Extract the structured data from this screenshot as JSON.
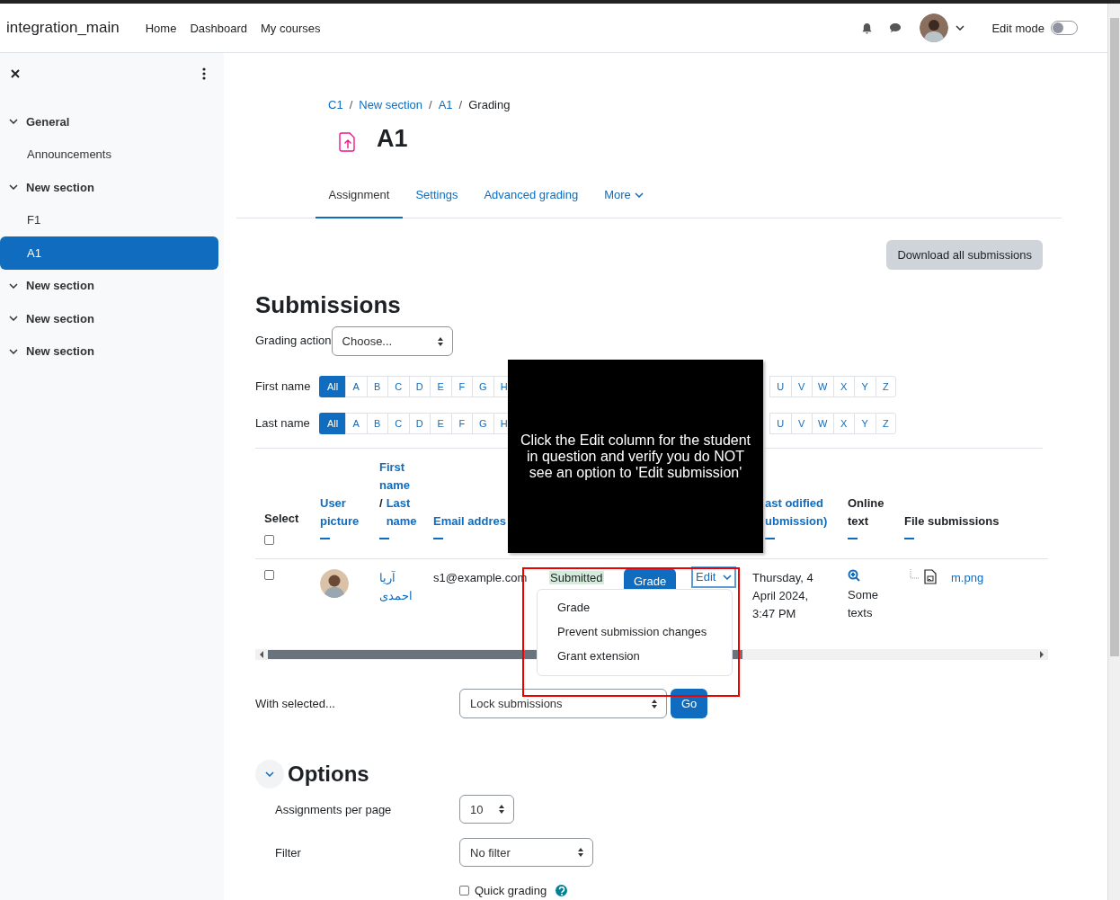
{
  "site_name": "integration_main",
  "nav": [
    {
      "label": "Home"
    },
    {
      "label": "Dashboard"
    },
    {
      "label": "My courses"
    }
  ],
  "edit_mode": {
    "label": "Edit mode",
    "on": false
  },
  "sidebar": {
    "items": [
      {
        "kind": "section",
        "label": "General",
        "expanded": true,
        "selected": false
      },
      {
        "kind": "activity",
        "label": "Announcements",
        "selected": false
      },
      {
        "kind": "section",
        "label": "New section",
        "expanded": true,
        "selected": false
      },
      {
        "kind": "activity",
        "label": "F1",
        "selected": false
      },
      {
        "kind": "activity",
        "label": "A1",
        "selected": true
      },
      {
        "kind": "section",
        "label": "New section",
        "expanded": true,
        "selected": false
      },
      {
        "kind": "section",
        "label": "New section",
        "expanded": true,
        "selected": false
      },
      {
        "kind": "section",
        "label": "New section",
        "expanded": true,
        "selected": false
      }
    ]
  },
  "breadcrumb": [
    {
      "label": "C1",
      "link": true
    },
    {
      "separator": "/",
      "label": "New section",
      "link": true
    },
    {
      "separator": "/",
      "label": "A1",
      "link": true
    },
    {
      "separator": "/",
      "label": "Grading",
      "link": false
    }
  ],
  "title": "A1",
  "tabs": [
    {
      "label": "Assignment",
      "selected": true,
      "menu": false
    },
    {
      "label": "Settings",
      "selected": false,
      "menu": false
    },
    {
      "label": "Advanced grading",
      "selected": false,
      "menu": false
    },
    {
      "label": "More",
      "selected": false,
      "menu": true
    }
  ],
  "download_button": "Download all submissions",
  "heading": "Submissions",
  "grading_action": {
    "label": "Grading action",
    "value": "Choose..."
  },
  "initials_filters": [
    {
      "label": "First name",
      "letters": [
        {
          "label": "All",
          "selected": true
        },
        {
          "label": "A",
          "selected": false
        },
        {
          "label": "B",
          "selected": false
        },
        {
          "label": "C",
          "selected": false
        },
        {
          "label": "D",
          "selected": false
        },
        {
          "label": "E",
          "selected": false
        },
        {
          "label": "F",
          "selected": false
        },
        {
          "label": "G",
          "selected": false
        },
        {
          "label": "H",
          "selected": false
        }
      ],
      "letters_right": [
        {
          "label": "U",
          "selected": false
        },
        {
          "label": "V",
          "selected": false
        },
        {
          "label": "W",
          "selected": false
        },
        {
          "label": "X",
          "selected": false
        },
        {
          "label": "Y",
          "selected": false
        },
        {
          "label": "Z",
          "selected": false
        }
      ]
    },
    {
      "label": "Last name",
      "letters": [
        {
          "label": "All",
          "selected": true
        },
        {
          "label": "A",
          "selected": false
        },
        {
          "label": "B",
          "selected": false
        },
        {
          "label": "C",
          "selected": false
        },
        {
          "label": "D",
          "selected": false
        },
        {
          "label": "E",
          "selected": false
        },
        {
          "label": "F",
          "selected": false
        },
        {
          "label": "G",
          "selected": false
        },
        {
          "label": "H",
          "selected": false
        }
      ],
      "letters_right": [
        {
          "label": "U",
          "selected": false
        },
        {
          "label": "V",
          "selected": false
        },
        {
          "label": "W",
          "selected": false
        },
        {
          "label": "X",
          "selected": false
        },
        {
          "label": "Y",
          "selected": false
        },
        {
          "label": "Z",
          "selected": false
        }
      ]
    }
  ],
  "table": {
    "columns": [
      {
        "kind": "select",
        "label": "Select",
        "checked": false
      },
      {
        "kind": "sortable",
        "label": "User picture"
      },
      {
        "kind": "name",
        "first": "First name",
        "separator": "/",
        "last": "Last name"
      },
      {
        "kind": "sortable",
        "label": "Email addres"
      },
      {
        "kind": "hidden"
      },
      {
        "kind": "hidden"
      },
      {
        "kind": "hidden"
      },
      {
        "kind": "sortable",
        "label": "ast odified ubmission)"
      },
      {
        "kind": "plain_sort",
        "label": "Online text"
      },
      {
        "kind": "plain_sort",
        "label": "File submissions"
      }
    ],
    "rows": [
      {
        "checked": false,
        "name": "آریا احمدی",
        "email": "s1@example.com",
        "status": "Submitted",
        "grade_button": "Grade",
        "edit_button": "Edit",
        "last_modified": "Thursday, 4 April 2024, 3:47 PM",
        "online_text": "Some texts",
        "file": "m.png"
      }
    ]
  },
  "edit_menu": {
    "items": [
      "Grade",
      "Prevent submission changes",
      "Grant extension"
    ]
  },
  "instruction_overlay": {
    "text": "Click the Edit column for the student in question and verify you do NOT see an option to 'Edit submission'"
  },
  "with_selected": {
    "label": "With selected...",
    "value": "Lock submissions",
    "button": "Go"
  },
  "options": {
    "title": "Options",
    "expanded": true,
    "per_page": {
      "label": "Assignments per page",
      "value": "10"
    },
    "filter": {
      "label": "Filter",
      "value": "No filter"
    },
    "quick_grading": {
      "label": "Quick grading",
      "checked": false
    }
  }
}
